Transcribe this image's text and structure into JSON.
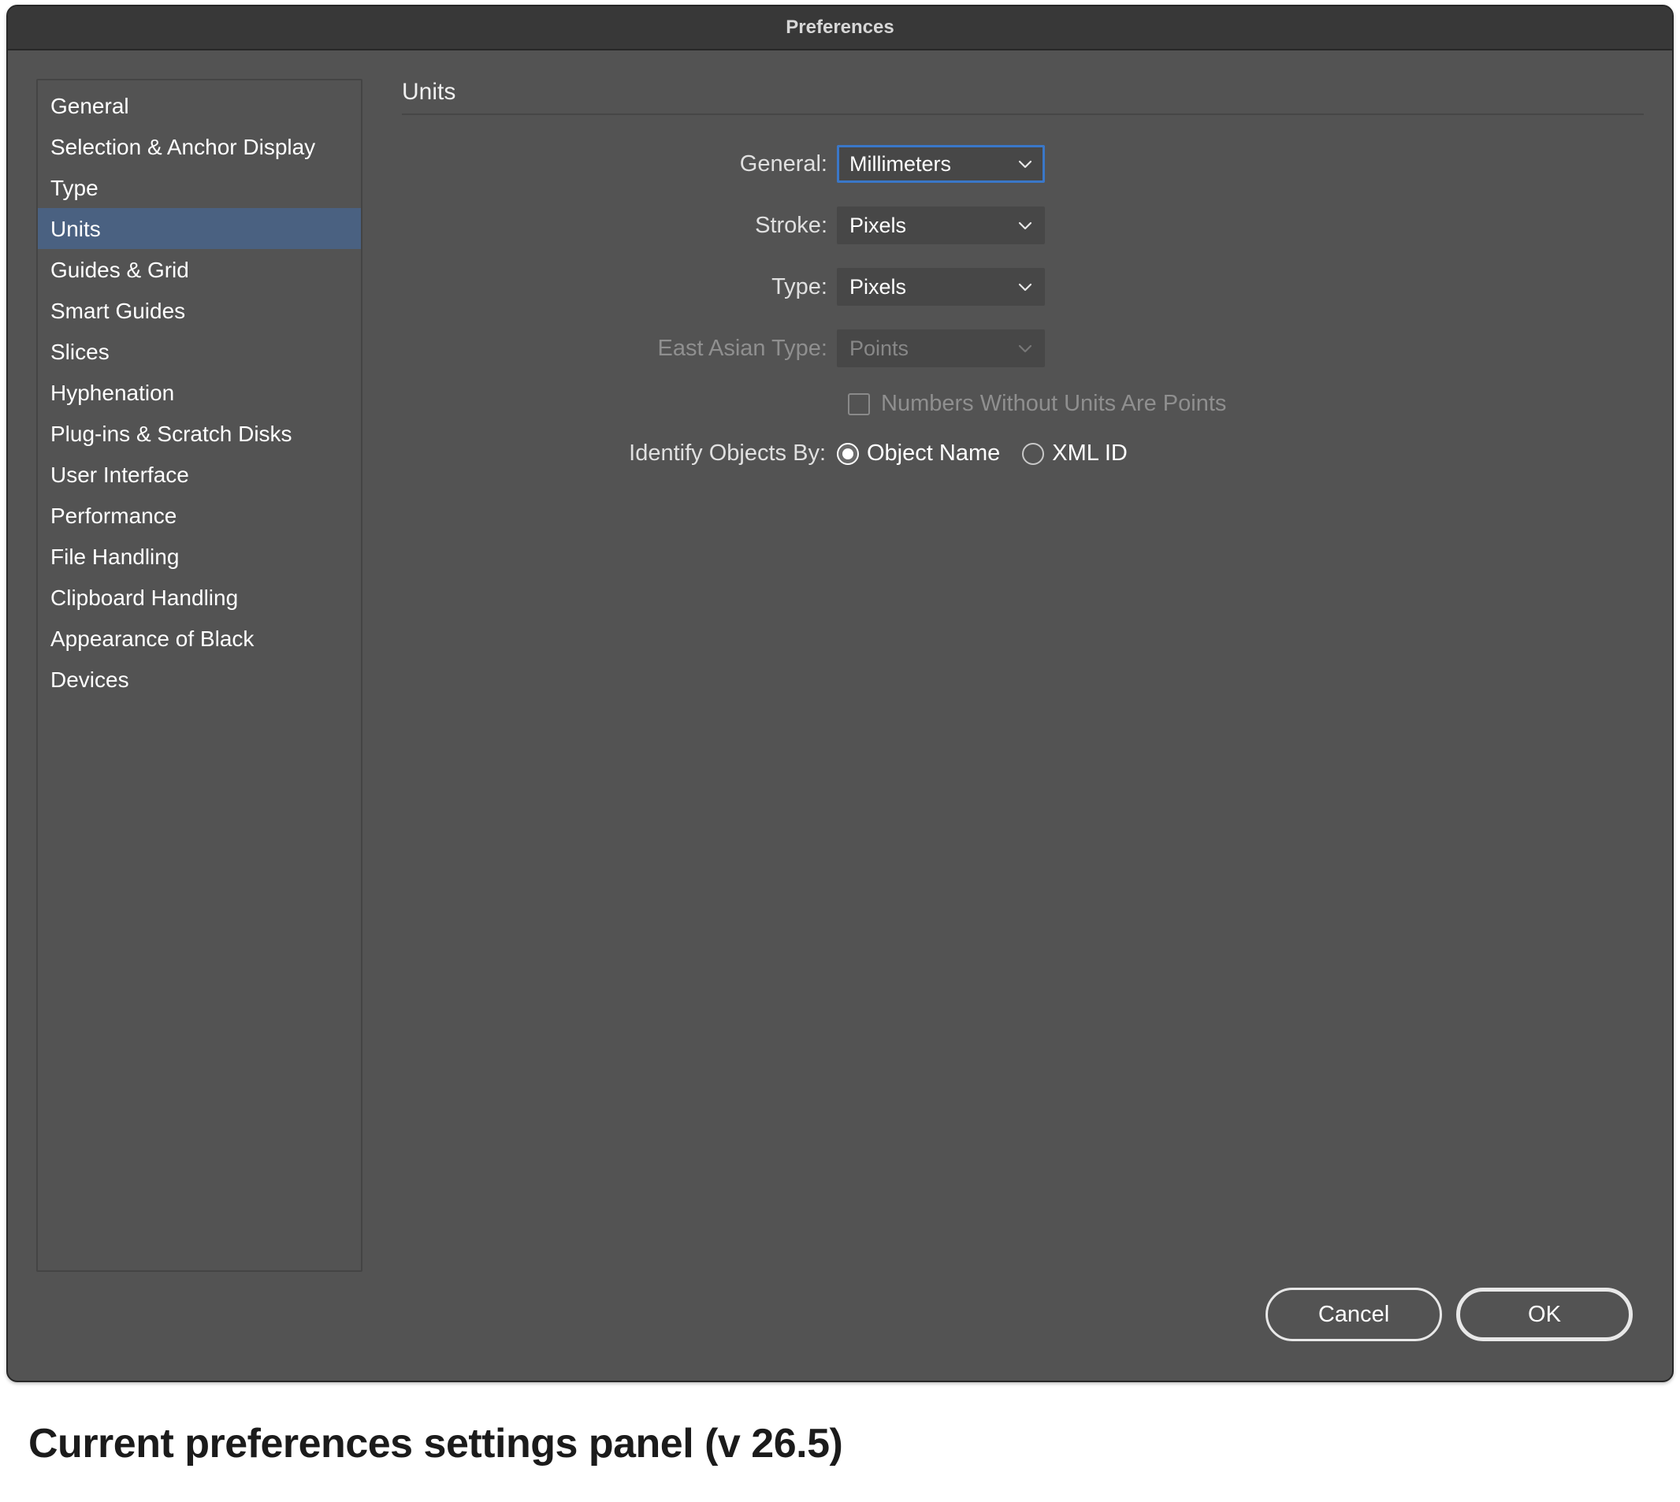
{
  "dialog": {
    "title": "Preferences",
    "section_title": "Units",
    "sidebar": {
      "items": [
        {
          "label": "General",
          "selected": false
        },
        {
          "label": "Selection & Anchor Display",
          "selected": false
        },
        {
          "label": "Type",
          "selected": false
        },
        {
          "label": "Units",
          "selected": true
        },
        {
          "label": "Guides & Grid",
          "selected": false
        },
        {
          "label": "Smart Guides",
          "selected": false
        },
        {
          "label": "Slices",
          "selected": false
        },
        {
          "label": "Hyphenation",
          "selected": false
        },
        {
          "label": "Plug-ins & Scratch Disks",
          "selected": false
        },
        {
          "label": "User Interface",
          "selected": false
        },
        {
          "label": "Performance",
          "selected": false
        },
        {
          "label": "File Handling",
          "selected": false
        },
        {
          "label": "Clipboard Handling",
          "selected": false
        },
        {
          "label": "Appearance of Black",
          "selected": false
        },
        {
          "label": "Devices",
          "selected": false
        }
      ]
    },
    "form": {
      "general": {
        "label": "General:",
        "value": "Millimeters",
        "focused": true,
        "disabled": false
      },
      "stroke": {
        "label": "Stroke:",
        "value": "Pixels",
        "focused": false,
        "disabled": false
      },
      "type": {
        "label": "Type:",
        "value": "Pixels",
        "focused": false,
        "disabled": false
      },
      "east_asian_type": {
        "label": "East Asian Type:",
        "value": "Points",
        "focused": false,
        "disabled": true
      },
      "numbers_without_units": {
        "label": "Numbers Without Units Are Points",
        "checked": false,
        "disabled": true
      },
      "identify_objects": {
        "lead_label": "Identify Objects By:",
        "options": [
          {
            "label": "Object Name",
            "selected": true
          },
          {
            "label": "XML ID",
            "selected": false
          }
        ]
      }
    },
    "buttons": {
      "cancel": "Cancel",
      "ok": "OK"
    }
  },
  "caption": "Current preferences settings panel (v 26.5)"
}
